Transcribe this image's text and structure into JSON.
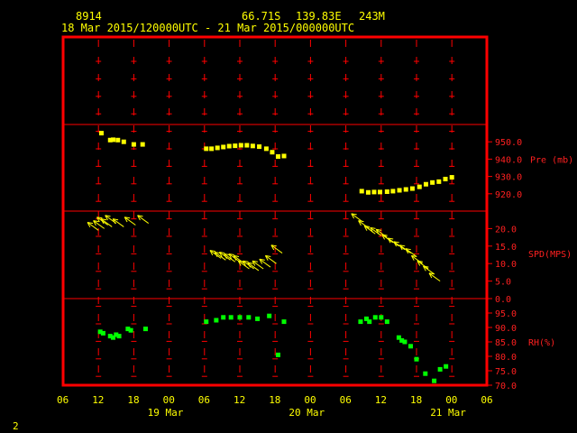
{
  "header": {
    "station_id": "8914",
    "lat": "66.71S",
    "lon": "139.83E",
    "elev": "243M",
    "time_range": "18 Mar 2015/120000UTC - 21 Mar 2015/000000UTC"
  },
  "corner_label": "2",
  "colors": {
    "frame": "#ff0000",
    "pressure": "#ffff00",
    "wind": "#ffff00",
    "rh": "#00ff00",
    "text": "#ffff00",
    "axis_label": "#ff2020"
  },
  "chart_data": [
    {
      "type": "scatter",
      "title": "Pre (mb)",
      "ylabel": "Pre (mb)",
      "ylim": [
        910,
        960
      ],
      "yticks": [
        "950.0",
        "940.0",
        "930.0",
        "920.0"
      ],
      "x_unit": "hours since 18 Mar 2015 06UTC",
      "x": [
        6.5,
        8.0,
        8.5,
        9.3,
        10.3,
        12.0,
        13.5,
        24.3,
        25.2,
        26.2,
        27.2,
        28.2,
        29.2,
        30.2,
        31.2,
        32.2,
        33.3,
        34.5,
        35.5,
        36.5,
        37.5,
        50.7,
        51.8,
        52.8,
        53.8,
        55.0,
        56.0,
        57.1,
        58.2,
        59.3,
        60.5,
        61.6,
        62.7,
        63.8,
        64.9,
        66.0
      ],
      "y": [
        955.0,
        951.0,
        951.2,
        951.0,
        950.0,
        948.5,
        948.5,
        946.0,
        946.0,
        946.5,
        947.0,
        947.5,
        947.7,
        948.0,
        948.0,
        947.6,
        947.2,
        946.0,
        944.0,
        941.5,
        941.8,
        921.5,
        920.8,
        921.0,
        921.0,
        921.2,
        921.5,
        922.0,
        922.5,
        923.0,
        924.0,
        925.5,
        926.5,
        927.0,
        928.5,
        929.5
      ]
    },
    {
      "type": "vector",
      "title": "SPD(MPS)",
      "ylabel": "SPD(MPS)",
      "ylim": [
        0,
        25
      ],
      "yticks": [
        "20.0",
        "15.0",
        "10.0",
        "5.0",
        "0.0"
      ],
      "x_unit": "hours since 18 Mar 2015 06UTC",
      "x": [
        6.0,
        7.0,
        7.6,
        8.3,
        9.0,
        10.3,
        12.3,
        14.5,
        26.8,
        27.6,
        28.4,
        29.2,
        30.0,
        30.8,
        31.6,
        32.4,
        33.2,
        34.0,
        35.2,
        36.2,
        37.2,
        50.8,
        52.0,
        53.0,
        54.0,
        55.0,
        56.0,
        57.0,
        58.0,
        59.0,
        60.0,
        61.0,
        62.0,
        63.0,
        64.0
      ],
      "speed": [
        19.5,
        20.0,
        21.0,
        20.5,
        21.5,
        20.5,
        21.0,
        21.5,
        11.5,
        11.0,
        11.0,
        10.5,
        10.5,
        10.0,
        8.5,
        8.5,
        8.0,
        8.5,
        9.0,
        10.0,
        13.0,
        22.0,
        20.0,
        18.5,
        18.0,
        17.5,
        16.0,
        15.0,
        14.0,
        13.0,
        12.0,
        10.0,
        8.5,
        7.0,
        5.0
      ]
    },
    {
      "type": "scatter",
      "title": "RH(%)",
      "ylabel": "RH(%)",
      "ylim": [
        70,
        100
      ],
      "yticks": [
        "95.0",
        "90.0",
        "85.0",
        "80.0",
        "75.0",
        "70.0"
      ],
      "x_unit": "hours since 18 Mar 2015 06UTC",
      "x": [
        6.3,
        6.8,
        8.0,
        8.5,
        9.0,
        9.5,
        11.0,
        11.5,
        14.0,
        24.3,
        26.0,
        27.2,
        28.5,
        30.0,
        31.5,
        33.0,
        35.0,
        36.5,
        37.5,
        50.5,
        51.5,
        52.0,
        53.0,
        54.0,
        55.0,
        57.0,
        57.5,
        58.0,
        59.0,
        60.0,
        61.5,
        63.0,
        64.0,
        65.0
      ],
      "y": [
        88.5,
        88.0,
        87.0,
        86.5,
        87.5,
        87.0,
        89.5,
        89.0,
        89.5,
        92.0,
        92.5,
        93.5,
        93.5,
        93.5,
        93.5,
        93.0,
        94.0,
        80.5,
        92.0,
        92.0,
        93.0,
        92.0,
        93.5,
        93.5,
        92.0,
        86.5,
        85.5,
        85.0,
        83.5,
        79.0,
        74.0,
        71.5,
        75.5,
        76.5
      ]
    }
  ],
  "x_axis": {
    "hour_labels": [
      "06",
      "12",
      "18",
      "00",
      "06",
      "12",
      "18",
      "00",
      "06",
      "12",
      "18",
      "00",
      "06"
    ],
    "day_labels": [
      "19 Mar",
      "20 Mar",
      "21 Mar"
    ]
  }
}
